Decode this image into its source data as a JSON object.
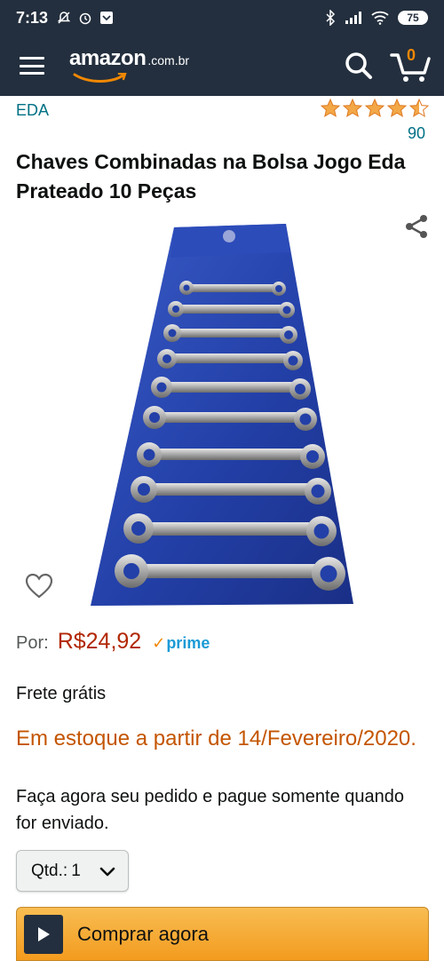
{
  "status_bar": {
    "time": "7:13",
    "battery": "75"
  },
  "nav": {
    "logo_brand": "amazon",
    "logo_domain": ".com.br",
    "cart_count": "0"
  },
  "product": {
    "brand": "EDA",
    "rating": 4.5,
    "review_count": "90",
    "title": "Chaves Combinadas na Bolsa Jogo Eda Prateado 10 Peças"
  },
  "price": {
    "label": "Por:",
    "value": "R$24,92",
    "prime_check": "✓",
    "prime_label": "prime"
  },
  "shipping": "Frete grátis",
  "stock": {
    "availability": "Em estoque a partir de 14/Fevereiro/2020.",
    "note": "Faça agora seu pedido e pague somente quando for enviado."
  },
  "quantity": {
    "label": "Qtd.:",
    "value": "1"
  },
  "buy_now_label": "Comprar agora",
  "colors": {
    "header_bg": "#232f3e",
    "link": "#007185",
    "price": "#b12704",
    "stock": "#c45500",
    "star": "#f3a847",
    "buy_button": "#f6a935"
  }
}
